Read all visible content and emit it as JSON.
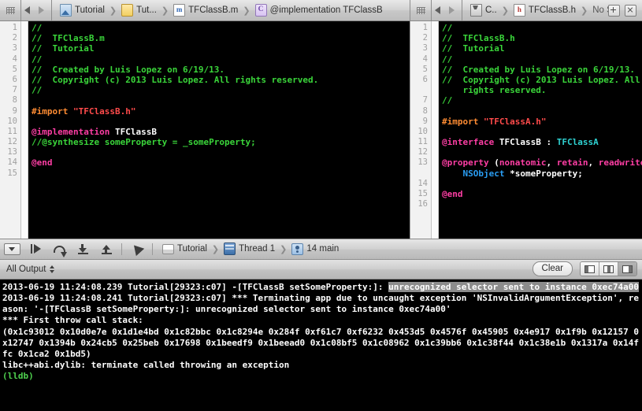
{
  "jumpbar": {
    "left": {
      "grip_icon": "grip-dots-icon",
      "back_icon": "chevron-left-icon",
      "forward_icon": "chevron-right-icon",
      "crumbs": [
        {
          "label": "Tutorial",
          "icon": "project-icon"
        },
        {
          "label": "Tut...",
          "icon": "folder-icon"
        },
        {
          "label": "TFClassB.m",
          "icon": "objc-implementation-file-icon"
        },
        {
          "label": "@implementation TFClassB",
          "icon": "class-symbol-icon"
        }
      ]
    },
    "right": {
      "grip_icon": "grip-dots-icon",
      "back_icon": "chevron-left-icon",
      "forward_icon": "chevron-right-icon",
      "crumbs": [
        {
          "label": "C..",
          "icon": "target-icon"
        },
        {
          "label": "TFClassB.h",
          "icon": "objc-header-file-icon"
        },
        {
          "label": "No Selection",
          "icon": ""
        }
      ],
      "add_editor_icon": "add-assistant-editor-icon",
      "close_editor_icon": "close-assistant-editor-icon"
    }
  },
  "editor_left": {
    "file": "TFClassB.m",
    "line_numbers": [
      "1",
      "2",
      "3",
      "4",
      "5",
      "6",
      "7",
      "8",
      "9",
      "10",
      "11",
      "12",
      "13",
      "14",
      "15"
    ],
    "lines": [
      [
        {
          "t": "//",
          "c": "c-com"
        }
      ],
      [
        {
          "t": "//  TFClassB.m",
          "c": "c-com"
        }
      ],
      [
        {
          "t": "//  Tutorial",
          "c": "c-com"
        }
      ],
      [
        {
          "t": "//",
          "c": "c-com"
        }
      ],
      [
        {
          "t": "//  Created by Luis Lopez on 6/19/13.",
          "c": "c-com"
        }
      ],
      [
        {
          "t": "//  Copyright (c) 2013 Luis Lopez. All rights reserved.",
          "c": "c-com"
        }
      ],
      [
        {
          "t": "//",
          "c": "c-com"
        }
      ],
      [
        {
          "t": "",
          "c": "c-plain"
        }
      ],
      [
        {
          "t": "#import ",
          "c": "c-pre"
        },
        {
          "t": "\"TFClassB.h\"",
          "c": "c-str"
        }
      ],
      [
        {
          "t": "",
          "c": "c-plain"
        }
      ],
      [
        {
          "t": "@implementation ",
          "c": "c-key"
        },
        {
          "t": "TFClassB",
          "c": "c-cls"
        }
      ],
      [
        {
          "t": "//@synthesize someProperty = _someProperty;",
          "c": "c-com"
        }
      ],
      [
        {
          "t": "",
          "c": "c-plain"
        }
      ],
      [
        {
          "t": "@end",
          "c": "c-key"
        }
      ],
      [
        {
          "t": "",
          "c": "c-plain"
        }
      ]
    ]
  },
  "editor_right": {
    "file": "TFClassB.h",
    "line_numbers": [
      "1",
      "2",
      "3",
      "4",
      "5",
      "6",
      "",
      "7",
      "8",
      "9",
      "10",
      "11",
      "12",
      "13",
      "",
      "14",
      "15",
      "16"
    ],
    "lines": [
      [
        {
          "t": "//",
          "c": "c-com"
        }
      ],
      [
        {
          "t": "//  TFClassB.h",
          "c": "c-com"
        }
      ],
      [
        {
          "t": "//  Tutorial",
          "c": "c-com"
        }
      ],
      [
        {
          "t": "//",
          "c": "c-com"
        }
      ],
      [
        {
          "t": "//  Created by Luis Lopez on 6/19/13.",
          "c": "c-com"
        }
      ],
      [
        {
          "t": "//  Copyright (c) 2013 Luis Lopez. All",
          "c": "c-com"
        }
      ],
      [
        {
          "t": "    rights reserved.",
          "c": "c-com"
        }
      ],
      [
        {
          "t": "//",
          "c": "c-com"
        }
      ],
      [
        {
          "t": "",
          "c": "c-plain"
        }
      ],
      [
        {
          "t": "#import ",
          "c": "c-pre"
        },
        {
          "t": "\"TFClassA.h\"",
          "c": "c-str"
        }
      ],
      [
        {
          "t": "",
          "c": "c-plain"
        }
      ],
      [
        {
          "t": "@interface ",
          "c": "c-key"
        },
        {
          "t": "TFClassB",
          "c": "c-cls"
        },
        {
          "t": " : ",
          "c": "c-plain"
        },
        {
          "t": "TFClassA",
          "c": "c-type"
        }
      ],
      [
        {
          "t": "",
          "c": "c-plain"
        }
      ],
      [
        {
          "t": "@property ",
          "c": "c-key"
        },
        {
          "t": "(",
          "c": "c-plain"
        },
        {
          "t": "nonatomic",
          "c": "c-key"
        },
        {
          "t": ", ",
          "c": "c-plain"
        },
        {
          "t": "retain",
          "c": "c-key"
        },
        {
          "t": ", ",
          "c": "c-plain"
        },
        {
          "t": "readwrite",
          "c": "c-key"
        },
        {
          "t": ")",
          "c": "c-plain"
        }
      ],
      [
        {
          "t": "    ",
          "c": "c-plain"
        },
        {
          "t": "NSObject",
          "c": "c-blue"
        },
        {
          "t": " *someProperty;",
          "c": "c-cls"
        }
      ],
      [
        {
          "t": "",
          "c": "c-plain"
        }
      ],
      [
        {
          "t": "@end",
          "c": "c-key"
        }
      ],
      [
        {
          "t": "",
          "c": "c-plain"
        }
      ]
    ]
  },
  "debugbar": {
    "toggle_debug_area_icon": "show-hide-debug-area-icon",
    "continue_icon": "continue-program-icon",
    "step_over_icon": "step-over-icon",
    "step_into_icon": "step-into-icon",
    "step_out_icon": "step-out-icon",
    "simulate_location_icon": "simulate-location-icon",
    "crumbs": [
      {
        "label": "Tutorial",
        "icon": "scheme-icon"
      },
      {
        "label": "Thread 1",
        "icon": "thread-icon"
      },
      {
        "label": "14 main",
        "icon": "stack-frame-icon"
      }
    ]
  },
  "console_header": {
    "filter_label": "All Output",
    "filter_stepper_icon": "stepper-updown-icon",
    "clear_label": "Clear",
    "segments": [
      {
        "name": "show-variables-only",
        "icon": "panel-left-icon",
        "active": false
      },
      {
        "name": "show-variables-and-console",
        "icon": "panel-split-icon",
        "active": false
      },
      {
        "name": "show-console-only",
        "icon": "panel-right-icon",
        "active": true
      }
    ]
  },
  "console": {
    "lines": [
      [
        {
          "t": "2013-06-19 11:24:08.239 Tutorial[29323:c07] -[TFClassB setSomeProperty:]: ",
          "sel": false
        },
        {
          "t": "unrecognized selector sent to instance 0xec74a00",
          "sel": true
        }
      ],
      [
        {
          "t": "2013-06-19 11:24:08.241 Tutorial[29323:c07] *** Terminating app due to uncaught exception 'NSInvalidArgumentException', reason: '-[TFClassB setSomeProperty:]: unrecognized selector sent to instance 0xec74a00'",
          "sel": false
        }
      ],
      [
        {
          "t": "*** First throw call stack:",
          "sel": false
        }
      ],
      [
        {
          "t": "(0x1c93012 0x10d0e7e 0x1d1e4bd 0x1c82bbc 0x1c8294e 0x284f 0xf61c7 0xf6232 0x453d5 0x4576f 0x45905 0x4e917 0x1f9b 0x12157 0x12747 0x1394b 0x24cb5 0x25beb 0x17698 0x1beedf9 0x1beead0 0x1c08bf5 0x1c08962 0x1c39bb6 0x1c38f44 0x1c38e1b 0x1317a 0x14ffc 0x1ca2 0x1bd5)",
          "sel": false
        }
      ],
      [
        {
          "t": "libc++abi.dylib: terminate called throwing an exception",
          "sel": false
        }
      ],
      [
        {
          "t": "(lldb)",
          "sel": false,
          "lldb": true
        }
      ]
    ]
  }
}
